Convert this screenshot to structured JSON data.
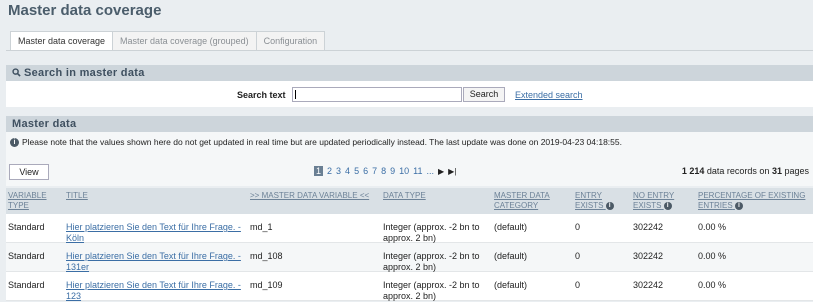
{
  "page": {
    "title": "Master data coverage"
  },
  "tabs": [
    {
      "label": "Master data coverage",
      "active": true
    },
    {
      "label": "Master data coverage (grouped)",
      "active": false
    },
    {
      "label": "Configuration",
      "active": false
    }
  ],
  "search": {
    "header": "Search in master data",
    "label": "Search text",
    "value": "",
    "button": "Search",
    "extended_link": "Extended search"
  },
  "master": {
    "header": "Master data",
    "notice": "Please note that the values shown here do not get updated in real time but are updated periodically instead. The last update was done on 2019-04-23 04:18:55.",
    "view_button": "View",
    "pager": {
      "current": "1",
      "pages": [
        "2",
        "3",
        "4",
        "5",
        "6",
        "7",
        "8",
        "9",
        "10",
        "11",
        "..."
      ],
      "next": "▶",
      "last": "▶|"
    },
    "records": {
      "count": "1 214",
      "middle": "data records on",
      "pages": "31",
      "suffix": "pages"
    },
    "columns": {
      "variable_type": "VARIABLE TYPE",
      "title": "TITLE",
      "variable": ">> MASTER DATA VARIABLE <<",
      "data_type": "DATA TYPE",
      "category": "MASTER DATA CATEGORY",
      "entry_exists": "ENTRY EXISTS",
      "no_entry_exists": "NO ENTRY EXISTS",
      "percentage": "PERCENTAGE OF EXISTING ENTRIES"
    },
    "rows": [
      {
        "type": "Standard",
        "title": "Hier platzieren Sie den Text für Ihre Frage. - Köln",
        "variable": "md_1",
        "data_type": "Integer (approx. -2 bn to approx. 2 bn)",
        "category": "(default)",
        "entry": "0",
        "no_entry": "302242",
        "percent": "0.00 %"
      },
      {
        "type": "Standard",
        "title": "Hier platzieren Sie den Text für Ihre Frage. - 131er",
        "variable": "md_108",
        "data_type": "Integer (approx. -2 bn to approx. 2 bn)",
        "category": "(default)",
        "entry": "0",
        "no_entry": "302242",
        "percent": "0.00 %"
      },
      {
        "type": "Standard",
        "title": "Hier platzieren Sie den Text für Ihre Frage. - 123",
        "variable": "md_109",
        "data_type": "Integer (approx. -2 bn to approx. 2 bn)",
        "category": "(default)",
        "entry": "0",
        "no_entry": "302242",
        "percent": "0.00 %"
      }
    ]
  }
}
